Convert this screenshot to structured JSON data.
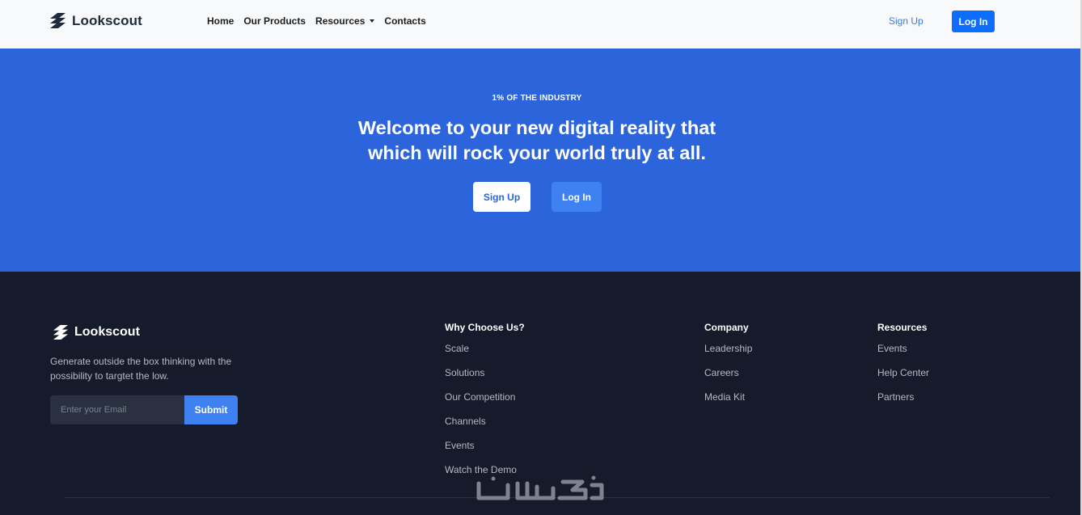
{
  "header": {
    "brand_name": "Lookscout",
    "nav": [
      {
        "label": "Home"
      },
      {
        "label": "Our Products"
      },
      {
        "label": "Resources"
      },
      {
        "label": "Contacts"
      }
    ],
    "sign_up_label": "Sign Up",
    "log_in_label": "Log In"
  },
  "hero": {
    "eyebrow": "1% OF THE INDUSTRY",
    "headline_line1": "Welcome to your new digital reality that",
    "headline_line2": "which will rock your world truly at all.",
    "sign_up_label": "Sign Up",
    "log_in_label": "Log In"
  },
  "footer": {
    "brand_name": "Lookscout",
    "tagline": "Generate outside the box thinking with the possibility to targtet the low.",
    "email_placeholder": "Enter your Email",
    "submit_label": "Submit",
    "columns": [
      {
        "heading": "Why Choose Us?",
        "links": [
          "Scale",
          "Solutions",
          "Our Competition",
          "Channels",
          "Events",
          "Watch the Demo"
        ]
      },
      {
        "heading": "Company",
        "links": [
          "Leadership",
          "Careers",
          "Media Kit"
        ]
      },
      {
        "heading": "Resources",
        "links": [
          "Events",
          "Help Center",
          "Partners"
        ]
      }
    ]
  },
  "icons": {
    "brand_logo": "stripes-logo-icon",
    "dropdown": "caret-down-icon"
  },
  "colors": {
    "primary": "#0d6efd",
    "hero_bg": "#2c65db",
    "footer_bg": "#161b2b"
  }
}
